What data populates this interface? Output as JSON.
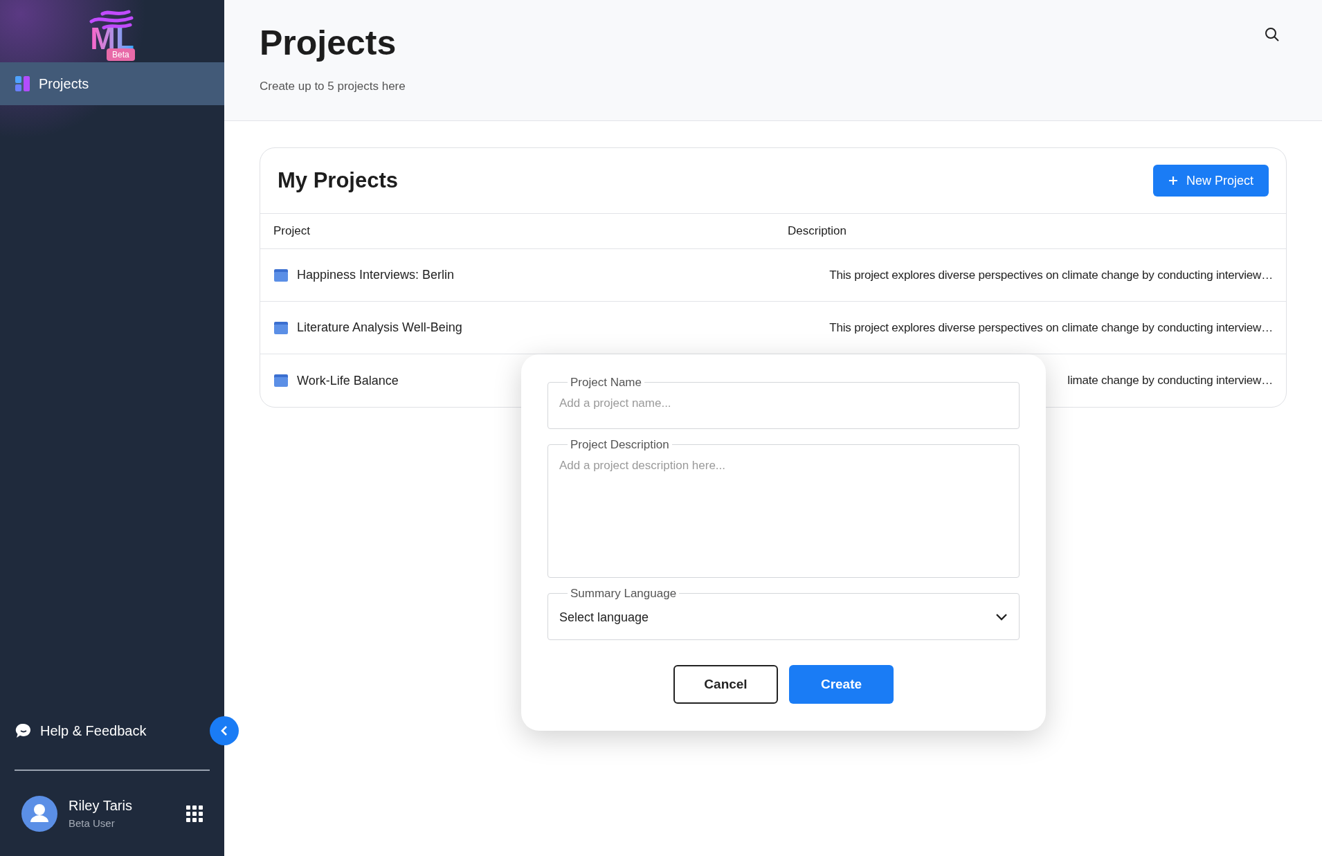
{
  "sidebar": {
    "logo": {
      "text": "ML",
      "badge": "Beta"
    },
    "items": [
      {
        "label": "Projects",
        "selected": true
      }
    ],
    "help": "Help & Feedback",
    "user": {
      "name": "Riley Taris",
      "role": "Beta User"
    }
  },
  "header": {
    "title": "Projects",
    "subtitle": "Create up to 5 projects here"
  },
  "card": {
    "title": "My Projects",
    "new_button": "New Project",
    "columns": [
      "Project",
      "Description"
    ],
    "rows": [
      {
        "name": "Happiness Interviews: Berlin",
        "description": "This project explores diverse perspectives on climate change by conducting interview…"
      },
      {
        "name": "Literature Analysis Well-Being",
        "description": "This project explores diverse perspectives on climate change by conducting interview…"
      },
      {
        "name": "Work-Life Balance",
        "description": "limate change by conducting interview…"
      }
    ]
  },
  "dialog": {
    "fields": [
      {
        "kind": "text",
        "label": "Project Name",
        "placeholder": "Add a project name..."
      },
      {
        "kind": "textarea",
        "label": "Project Description",
        "placeholder": "Add a project description here..."
      },
      {
        "kind": "select",
        "label": "Summary Language",
        "value": "Select language"
      }
    ],
    "buttons": [
      {
        "label": "Cancel",
        "kind": "secondary"
      },
      {
        "label": "Create",
        "kind": "primary"
      }
    ]
  }
}
